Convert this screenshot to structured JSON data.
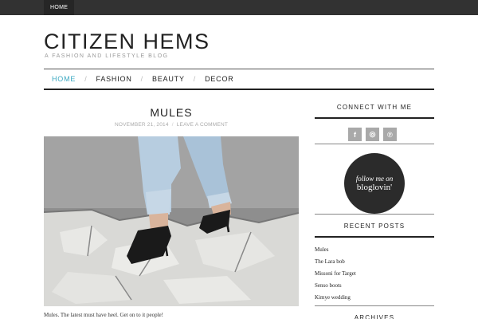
{
  "topbar": {
    "home_label": "HOME"
  },
  "site": {
    "title": "CITIZEN HEMS",
    "tagline": "A FASHION AND LIFESTYLE BLOG"
  },
  "nav": {
    "items": [
      "HOME",
      "FASHION",
      "BEAUTY",
      "DECOR"
    ],
    "active": "HOME",
    "active_color": "#3aa8c1"
  },
  "post": {
    "title": "MULES",
    "date": "NOVEMBER 21, 2014",
    "meta_sep": "/",
    "comment_link": "LEAVE A COMMENT",
    "excerpt": "Mules. The latest must have heel. Get on to it people!"
  },
  "sidebar": {
    "connect_title": "CONNECT WITH ME",
    "social_icons": [
      "facebook-icon",
      "instagram-icon",
      "pinterest-icon"
    ],
    "social_glyphs": [
      "f",
      "◎",
      "℗"
    ],
    "bloglovin_line1": "follow me on",
    "bloglovin_line2": "bloglovin'",
    "recent_title": "RECENT POSTS",
    "recent_posts": [
      "Mules",
      "The Lara bob",
      "Missoni for Target",
      "Senso boots",
      "Kimye wedding"
    ],
    "archives_title": "ARCHIVES"
  }
}
